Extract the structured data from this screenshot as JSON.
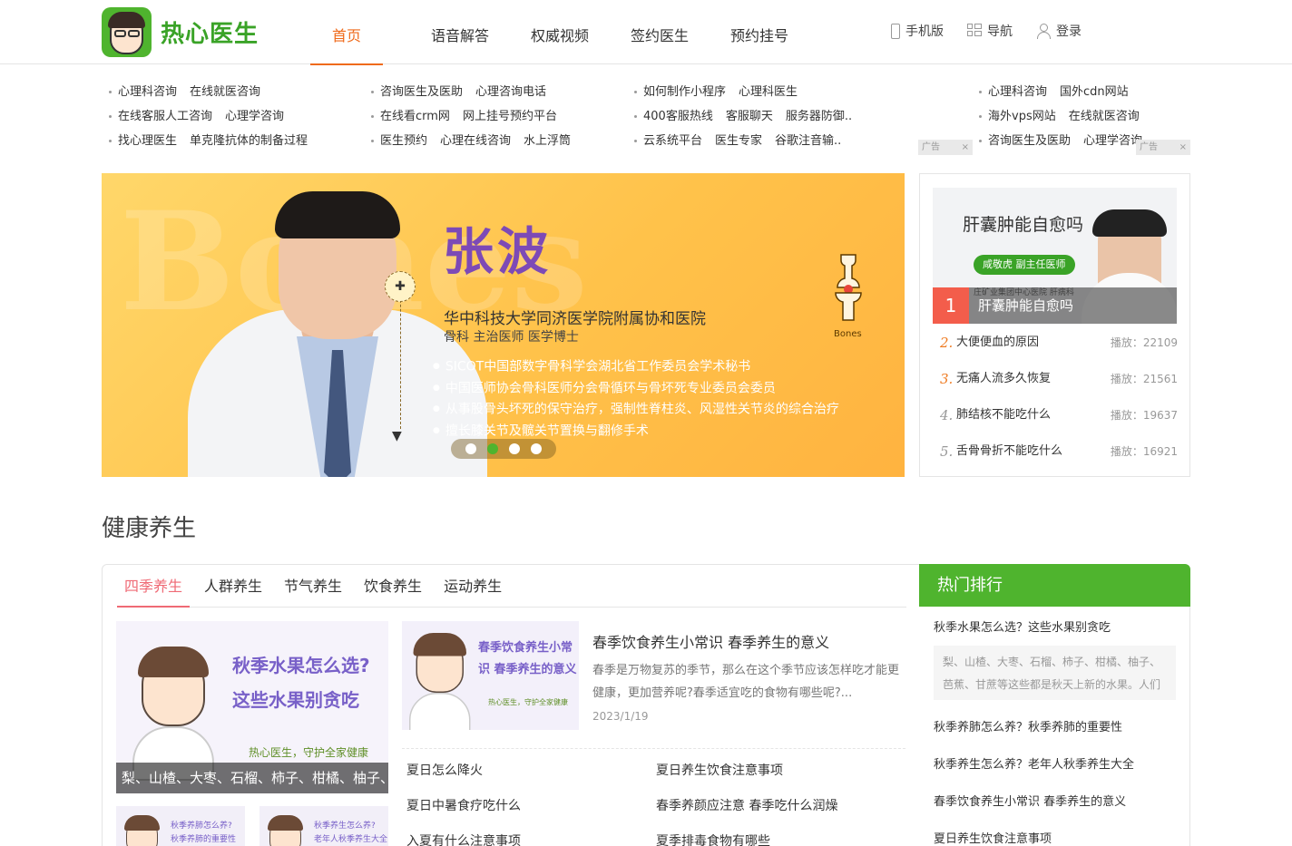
{
  "header": {
    "logo_text": "热心医生",
    "nav": [
      "首页",
      "语音解答",
      "权威视频",
      "签约医生",
      "预约挂号"
    ],
    "right": [
      "手机版",
      "导航",
      "登录"
    ]
  },
  "links": {
    "col1": [
      [
        "心理科咨询",
        "在线就医咨询"
      ],
      [
        "在线客服人工咨询",
        "心理学咨询"
      ],
      [
        "找心理医生",
        "单克隆抗体的制备过程"
      ]
    ],
    "col2": [
      [
        "咨询医生及医助",
        "心理咨询电话"
      ],
      [
        "在线看crm网",
        "网上挂号预约平台"
      ],
      [
        "医生预约",
        "心理在线咨询",
        "水上浮筒"
      ]
    ],
    "col3": [
      [
        "如何制作小程序",
        "心理科医生"
      ],
      [
        "400客服热线",
        "客服聊天",
        "服务器防御.."
      ],
      [
        "云系统平台",
        "医生专家",
        "谷歌注音输.."
      ]
    ],
    "col4": [
      [
        "心理科咨询",
        "国外cdn网站"
      ],
      [
        "海外vps网站",
        "在线就医咨询"
      ],
      [
        "咨询医生及医助",
        "心理学咨询"
      ]
    ],
    "ad_label": "广告",
    "ad_close": "×"
  },
  "banner": {
    "name": "张波",
    "hospital": "华中科技大学同济医学院附属协和医院",
    "title": "骨科  主治医师  医学博士",
    "items": [
      "SICOT中国部数字骨科学会湖北省工作委员会学术秘书",
      "中国医师协会骨科医师分会骨循环与骨坏死专业委员会委员",
      "从事股骨头坏死的保守治疗，强制性脊柱炎、风湿性关节炎的综合治疗",
      "擅长膝关节及髋关节置换与翻修手术"
    ],
    "bone_label": "Bones",
    "deco": "Bones",
    "active_dot": 2,
    "dot_count": 4
  },
  "rank": {
    "img_title": "肝囊肿能自愈吗",
    "img_chip": "咸敬虎 副主任医师",
    "img_sub": "庄矿业集团中心医院  肝病科",
    "first_num": "1",
    "first_title": "肝囊肿能自愈吗",
    "items": [
      {
        "n": "2.",
        "t": "大便便血的原因",
        "p": "播放：22109"
      },
      {
        "n": "3.",
        "t": "无痛人流多久恢复",
        "p": "播放：21561"
      },
      {
        "n": "4.",
        "t": "肺结核不能吃什么",
        "p": "播放：19637"
      },
      {
        "n": "5.",
        "t": "舌骨骨折不能吃什么",
        "p": "播放：16921"
      }
    ]
  },
  "section": {
    "title": "健康养生",
    "tabs": [
      "四季养生",
      "人群养生",
      "节气养生",
      "饮食养生",
      "运动养生"
    ],
    "feature": {
      "line1": "秋季水果怎么选?",
      "line2": "这些水果别贪吃",
      "slogan": "热心医生，守护全家健康",
      "caption": "梨、山楂、大枣、石榴、柿子、柑橘、柚子、"
    },
    "thumbs": [
      {
        "l1": "秋季养肺怎么养?",
        "l2": "秋季养肺的重要性"
      },
      {
        "l1": "秋季养生怎么养?",
        "l2": "老年人秋季养生大全"
      }
    ],
    "article": {
      "img_l1": "春季饮食养生小常",
      "img_l2": "识 春季养生的意义",
      "img_slogan": "热心医生，守护全家健康",
      "title": "春季饮食养生小常识 春季养生的意义",
      "desc": "春季是万物复苏的季节，那么在这个季节应该怎样吃才能更健康，更加营养呢?春季适宜吃的食物有哪些呢?...",
      "date": "2023/1/19"
    },
    "sublinks": [
      [
        "夏日怎么降火",
        "夏日养生饮食注意事项"
      ],
      [
        "夏日中暑食疗吃什么",
        "春季养颜应注意 春季吃什么润燥"
      ],
      [
        "入夏有什么注意事项",
        "夏季排毒食物有哪些"
      ]
    ]
  },
  "hot": {
    "title": "热门排行",
    "first": "秋季水果怎么选？这些水果别贪吃",
    "first_desc": "梨、山楂、大枣、石榴、柿子、柑橘、柚子、芭蕉、甘蔗等这些都是秋天上新的水果。人们",
    "items": [
      "秋季养肺怎么养？秋季养肺的重要性",
      "秋季养生怎么养？老年人秋季养生大全",
      "春季饮食养生小常识 春季养生的意义",
      "夏日养生饮食注意事项"
    ]
  }
}
